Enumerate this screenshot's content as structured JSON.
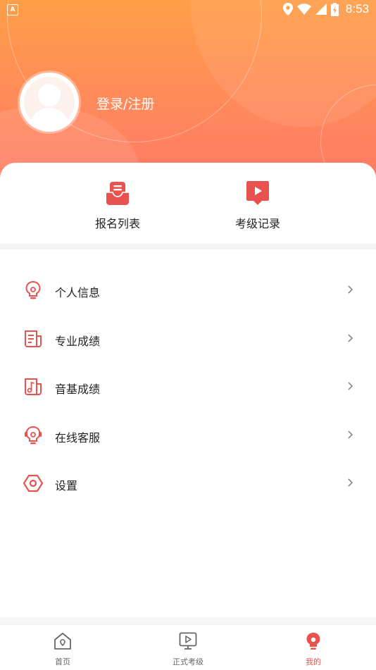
{
  "status_bar": {
    "app_badge": "A",
    "time": "8:53",
    "icons": [
      "location-icon",
      "wifi-icon",
      "signal-icon",
      "battery-icon"
    ]
  },
  "profile": {
    "login_label": "登录/注册"
  },
  "quick_actions": [
    {
      "label": "报名列表",
      "icon": "inbox-icon"
    },
    {
      "label": "考级记录",
      "icon": "play-bookmark-icon"
    }
  ],
  "menu": [
    {
      "label": "个人信息",
      "icon": "lightbulb-icon"
    },
    {
      "label": "专业成绩",
      "icon": "document-icon"
    },
    {
      "label": "音基成绩",
      "icon": "music-note-icon"
    },
    {
      "label": "在线客服",
      "icon": "headset-icon"
    },
    {
      "label": "设置",
      "icon": "settings-hex-icon"
    }
  ],
  "tabs": [
    {
      "label": "首页",
      "icon": "home-icon",
      "active": false
    },
    {
      "label": "正式考级",
      "icon": "video-play-icon",
      "active": false
    },
    {
      "label": "我的",
      "icon": "mine-icon",
      "active": true
    }
  ],
  "colors": {
    "accent": "#e8534f",
    "hero_top": "#ff9e47",
    "hero_bottom": "#ff7a66"
  }
}
